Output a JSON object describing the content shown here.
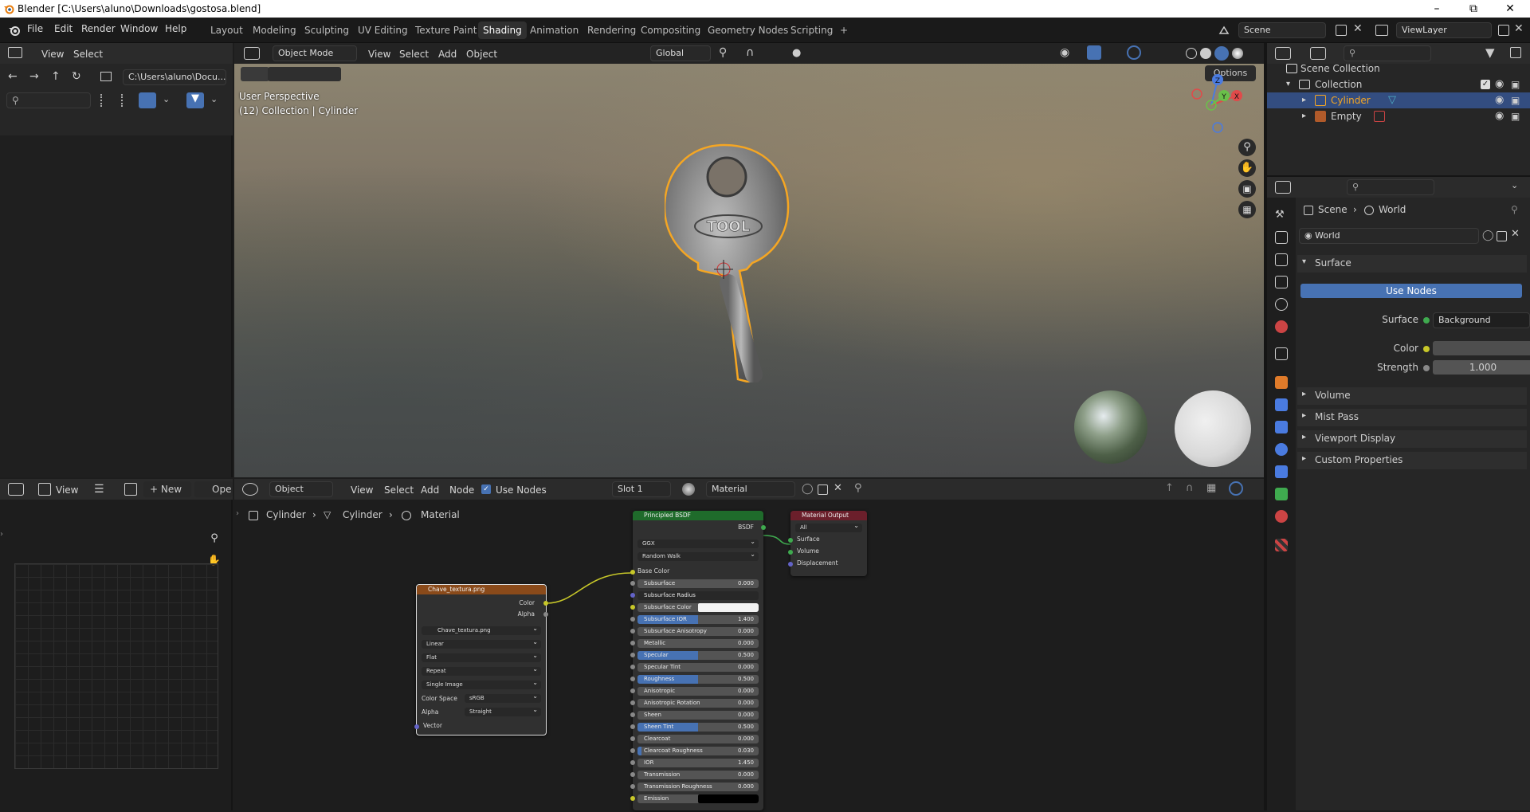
{
  "title_bar": {
    "title": "Blender [C:\\Users\\aluno\\Downloads\\gostosa.blend]"
  },
  "menu": [
    "File",
    "Edit",
    "Render",
    "Window",
    "Help"
  ],
  "workspaces": [
    "Layout",
    "Modeling",
    "Sculpting",
    "UV Editing",
    "Texture Paint",
    "Shading",
    "Animation",
    "Rendering",
    "Compositing",
    "Geometry Nodes",
    "Scripting",
    "+"
  ],
  "active_workspace": "Shading",
  "scene": {
    "label": "Scene",
    "view_layer": "ViewLayer"
  },
  "file_browser": {
    "view": "View",
    "select": "Select",
    "path": "C:\\Users\\aluno\\Docu..."
  },
  "viewport": {
    "mode": "Object Mode",
    "view": "View",
    "select": "Select",
    "add": "Add",
    "object": "Object",
    "orientation": "Global",
    "options": "Options",
    "info_line1": "User Perspective",
    "info_line2": "(12) Collection | Cylinder",
    "key_text": "TOOL",
    "gizmo": {
      "z": "Z",
      "y": "Y",
      "x": "X"
    }
  },
  "outliner": {
    "items": [
      {
        "label": "Scene Collection"
      },
      {
        "label": "Collection"
      },
      {
        "label": "Cylinder"
      },
      {
        "label": "Empty"
      }
    ]
  },
  "properties": {
    "breadcrumb_scene": "Scene",
    "breadcrumb_world": "World",
    "world_name": "World",
    "surface_section": "Surface",
    "use_nodes": "Use Nodes",
    "surface_label": "Surface",
    "surface_value": "Background",
    "color_label": "Color",
    "strength_label": "Strength",
    "strength_value": "1.000",
    "collapsed": [
      "Volume",
      "Mist Pass",
      "Viewport Display",
      "Custom Properties"
    ]
  },
  "image_editor": {
    "view": "View",
    "new": "New",
    "open": "Ope"
  },
  "shader_editor": {
    "object": "Object",
    "view": "View",
    "select": "Select",
    "add": "Add",
    "node": "Node",
    "use_nodes": "Use Nodes",
    "slot": "Slot 1",
    "material": "Material",
    "breadcrumb": [
      "Cylinder",
      "Cylinder",
      "Material"
    ]
  },
  "image_node": {
    "title": "Chave_textura.png",
    "out_color": "Color",
    "out_alpha": "Alpha",
    "image_name": "Chave_textura.png",
    "dropdowns": [
      "Linear",
      "Flat",
      "Repeat",
      "Single Image"
    ],
    "color_space_label": "Color Space",
    "color_space": "sRGB",
    "alpha_label": "Alpha",
    "alpha": "Straight",
    "vector": "Vector"
  },
  "bsdf_node": {
    "title": "Principled BSDF",
    "out": "BSDF",
    "dist": "GGX",
    "sss": "Random Walk",
    "base_color": "Base Color",
    "rows": [
      {
        "label": "Subsurface",
        "value": "0.000",
        "fill": 0
      },
      {
        "label": "Subsurface Radius",
        "value": "",
        "fill": 0
      },
      {
        "label": "Subsurface Color",
        "value": "",
        "fill": 0
      },
      {
        "label": "Subsurface IOR",
        "value": "1.400",
        "fill": 0.5
      },
      {
        "label": "Subsurface Anisotropy",
        "value": "0.000",
        "fill": 0
      },
      {
        "label": "Metallic",
        "value": "0.000",
        "fill": 0
      },
      {
        "label": "Specular",
        "value": "0.500",
        "fill": 0.5
      },
      {
        "label": "Specular Tint",
        "value": "0.000",
        "fill": 0
      },
      {
        "label": "Roughness",
        "value": "0.500",
        "fill": 0.5
      },
      {
        "label": "Anisotropic",
        "value": "0.000",
        "fill": 0
      },
      {
        "label": "Anisotropic Rotation",
        "value": "0.000",
        "fill": 0
      },
      {
        "label": "Sheen",
        "value": "0.000",
        "fill": 0
      },
      {
        "label": "Sheen Tint",
        "value": "0.500",
        "fill": 0.5
      },
      {
        "label": "Clearcoat",
        "value": "0.000",
        "fill": 0
      },
      {
        "label": "Clearcoat Roughness",
        "value": "0.030",
        "fill": 0.03
      },
      {
        "label": "IOR",
        "value": "1.450",
        "fill": 0
      },
      {
        "label": "Transmission",
        "value": "0.000",
        "fill": 0
      },
      {
        "label": "Transmission Roughness",
        "value": "0.000",
        "fill": 0
      },
      {
        "label": "Emission",
        "value": "",
        "fill": 0
      }
    ]
  },
  "output_node": {
    "title": "Material Output",
    "target": "All",
    "inputs": [
      "Surface",
      "Volume",
      "Displacement"
    ]
  },
  "colors": {
    "accent": "#4772b3",
    "selection": "#334d80",
    "bsdf_header": "#1f6b2b",
    "image_header": "#8a4a1a",
    "output_header": "#6b1f2b",
    "outline": "#f5a623"
  }
}
